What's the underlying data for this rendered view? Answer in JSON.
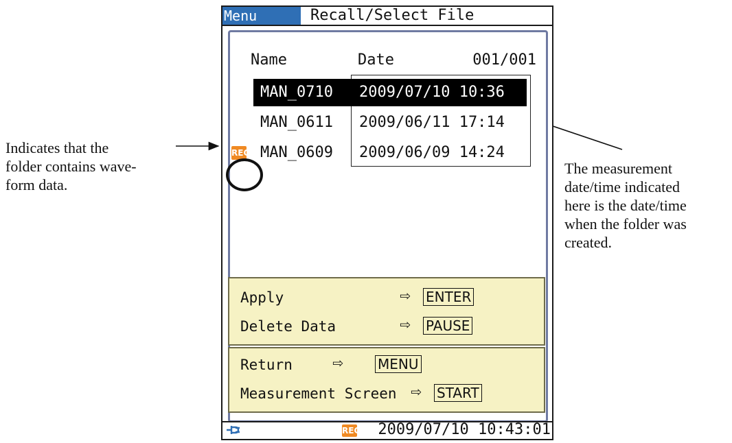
{
  "screen": {
    "menu_tab": "Menu",
    "title": "Recall/Select File",
    "list": {
      "col_name": "Name",
      "col_date": "Date",
      "page": "001/001",
      "rows": [
        {
          "name": "MAN_0710",
          "date": "2009/07/10 10:36",
          "selected": true,
          "rec": false
        },
        {
          "name": "MAN_0611",
          "date": "2009/06/11 17:14",
          "selected": false,
          "rec": false
        },
        {
          "name": "MAN_0609",
          "date": "2009/06/09 14:24",
          "selected": false,
          "rec": true
        }
      ]
    },
    "rec_badge": "REC",
    "actions_top": [
      {
        "label": "Apply",
        "arrow": "⇨",
        "key": "ENTER"
      },
      {
        "label": "Delete Data",
        "arrow": "⇨",
        "key": "PAUSE"
      }
    ],
    "actions_bottom": [
      {
        "label": "Return",
        "arrow": "⇨",
        "key": "MENU"
      },
      {
        "label": "Measurement Screen",
        "arrow": "⇨",
        "key": "START"
      }
    ],
    "status": {
      "rec_badge": "REC",
      "datetime": "2009/07/10 10:43:01",
      "icon": "plug-icon"
    }
  },
  "annotations": {
    "left": "Indicates that the folder contains wave-form data.",
    "left_lines": [
      "Indicates that the",
      "folder contains wave-",
      "form data."
    ],
    "right_lines": [
      "The measurement",
      "date/time indicated",
      "here is the date/time",
      "when the folder was",
      "created."
    ]
  },
  "colors": {
    "menu_tab_bg": "#2f6fb5",
    "rec_badge": "#f08a23",
    "panel_border": "#6f7aa2",
    "action_bg": "#f6f2c4"
  }
}
